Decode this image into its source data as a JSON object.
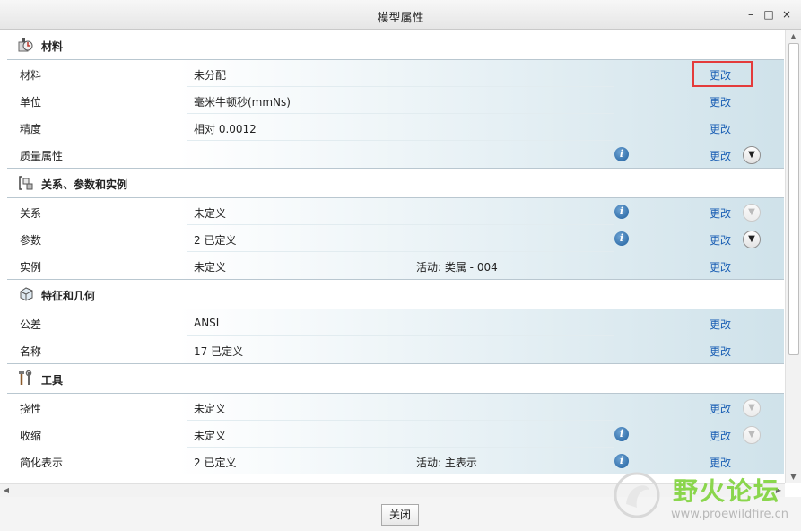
{
  "window": {
    "title": "模型属性",
    "minimize": "–",
    "maximize": "□",
    "close": "×"
  },
  "colors": {
    "link": "#1a5fb4",
    "highlight": "#e43b3b",
    "watermark_green": "#7fd33b"
  },
  "sections": [
    {
      "title": "材料",
      "icon": "material-icon",
      "rows": [
        {
          "name": "材料",
          "value": "未分配",
          "change": "更改"
        },
        {
          "name": "单位",
          "value": "毫米牛顿秒(mmNs)",
          "change": "更改"
        },
        {
          "name": "精度",
          "value": "相对 0.0012",
          "change": "更改"
        },
        {
          "name": "质量属性",
          "value": "",
          "change": "更改"
        }
      ]
    },
    {
      "title": "关系、参数和实例",
      "icon": "relations-icon",
      "rows": [
        {
          "name": "关系",
          "value": "未定义",
          "change": "更改"
        },
        {
          "name": "参数",
          "value": "2 已定义",
          "change": "更改"
        },
        {
          "name": "实例",
          "value": "未定义",
          "extra": "活动: 类属 - 004",
          "change": "更改"
        }
      ]
    },
    {
      "title": "特征和几何",
      "icon": "feature-geometry-icon",
      "rows": [
        {
          "name": "公差",
          "value": "ANSI",
          "change": "更改"
        },
        {
          "name": "名称",
          "value": "17 已定义",
          "change": "更改"
        }
      ]
    },
    {
      "title": "工具",
      "icon": "tools-icon",
      "rows": [
        {
          "name": "挠性",
          "value": "未定义",
          "change": "更改"
        },
        {
          "name": "收缩",
          "value": "未定义",
          "change": "更改"
        },
        {
          "name": "简化表示",
          "value": "2 已定义",
          "extra": "活动: 主表示",
          "change": "更改"
        }
      ]
    }
  ],
  "footer": {
    "close_label": "关闭"
  },
  "watermark": {
    "title": "野火论坛",
    "url": "www.proewildfire.cn"
  }
}
